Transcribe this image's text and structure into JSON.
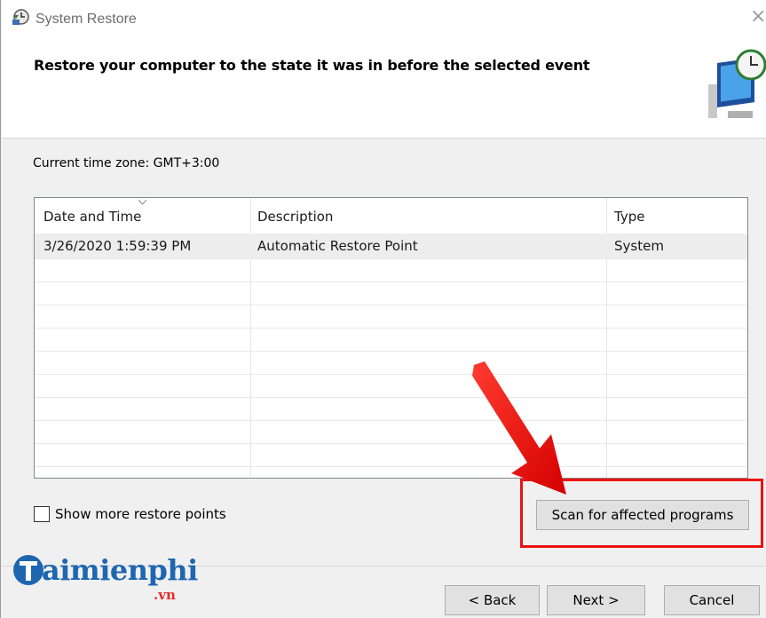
{
  "window": {
    "title": "System Restore",
    "heading": "Restore your computer to the state it was in before the selected event",
    "close_glyph": "×"
  },
  "timezone_label": "Current time zone: GMT+3:00",
  "table": {
    "columns": [
      "Date and Time",
      "Description",
      "Type"
    ],
    "rows": [
      [
        "3/26/2020 1:59:39 PM",
        "Automatic Restore Point",
        "System"
      ]
    ]
  },
  "show_more": {
    "label": "Show more restore points",
    "checked": false
  },
  "buttons": {
    "scan": "Scan for affected programs",
    "back": "< Back",
    "next": "Next >",
    "cancel": "Cancel"
  },
  "watermark": {
    "brand": "aimienphi",
    "tld": ".vn"
  },
  "colors": {
    "annotation": "#ee1111",
    "brand_blue": "#1f66b0",
    "brand_red": "#e52b2b"
  },
  "icons": [
    "system-restore-icon",
    "close-icon",
    "restore-computer-graphic",
    "sort-caret-icon",
    "annotation-arrow"
  ]
}
